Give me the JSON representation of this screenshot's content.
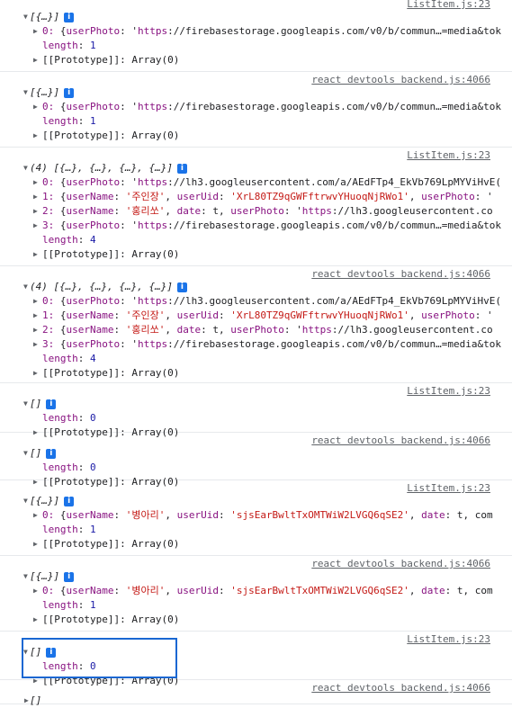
{
  "entries": [
    {
      "source": "ListItem.js:23",
      "top": 0,
      "header": "[{…}]",
      "expanded": true,
      "info": true,
      "items": [
        {
          "kind": "entry",
          "idx": "0",
          "value": "{userPhoto: 'https://firebasestorage.googleapis.com/v0/b/commun…=media&tok"
        },
        {
          "kind": "length",
          "value": "1"
        },
        {
          "kind": "proto",
          "value": "[[Prototype]]: Array(0)"
        }
      ]
    },
    {
      "source": "react devtools backend.js:4066",
      "header": "[{…}]",
      "expanded": true,
      "info": true,
      "items": [
        {
          "kind": "entry",
          "idx": "0",
          "value": "{userPhoto: 'https://firebasestorage.googleapis.com/v0/b/commun…=media&tok"
        },
        {
          "kind": "length",
          "value": "1"
        },
        {
          "kind": "proto",
          "value": "[[Prototype]]: Array(0)"
        }
      ]
    },
    {
      "source": "ListItem.js:23",
      "header": "(4) [{…}, {…}, {…}, {…}]",
      "expanded": true,
      "info": true,
      "items": [
        {
          "kind": "entry",
          "idx": "0",
          "value": "{userPhoto: 'https://lh3.googleusercontent.com/a/AEdFTp4_EkVb769LpMYViHvE("
        },
        {
          "kind": "entry",
          "idx": "1",
          "value": "{userName: '주인장', userUid: 'XrL80TZ9qGWFftrwvYHuoqNjRWo1', userPhoto: '"
        },
        {
          "kind": "entry",
          "idx": "2",
          "value": "{userName: '홍리쏘', date: t, userPhoto: 'https://lh3.googleusercontent.co"
        },
        {
          "kind": "entry",
          "idx": "3",
          "value": "{userPhoto: 'https://firebasestorage.googleapis.com/v0/b/commun…=media&tok"
        },
        {
          "kind": "length",
          "value": "4"
        },
        {
          "kind": "proto",
          "value": "[[Prototype]]: Array(0)"
        }
      ]
    },
    {
      "source": "react devtools backend.js:4066",
      "header": "(4) [{…}, {…}, {…}, {…}]",
      "expanded": true,
      "info": true,
      "items": [
        {
          "kind": "entry",
          "idx": "0",
          "value": "{userPhoto: 'https://lh3.googleusercontent.com/a/AEdFTp4_EkVb769LpMYViHvE("
        },
        {
          "kind": "entry",
          "idx": "1",
          "value": "{userName: '주인장', userUid: 'XrL80TZ9qGWFftrwvYHuoqNjRWo1', userPhoto: '"
        },
        {
          "kind": "entry",
          "idx": "2",
          "value": "{userName: '홍리쏘', date: t, userPhoto: 'https://lh3.googleusercontent.co"
        },
        {
          "kind": "entry",
          "idx": "3",
          "value": "{userPhoto: 'https://firebasestorage.googleapis.com/v0/b/commun…=media&tok"
        },
        {
          "kind": "length",
          "value": "4"
        },
        {
          "kind": "proto",
          "value": "[[Prototype]]: Array(0)"
        }
      ]
    },
    {
      "source": "ListItem.js:23",
      "header": "[]",
      "expanded": true,
      "info": true,
      "items": [
        {
          "kind": "length",
          "value": "0"
        },
        {
          "kind": "proto",
          "value": "[[Prototype]]: Array(0)"
        }
      ]
    },
    {
      "source": "react devtools backend.js:4066",
      "header": "[]",
      "expanded": true,
      "info": true,
      "items": [
        {
          "kind": "length",
          "value": "0"
        },
        {
          "kind": "proto",
          "value": "[[Prototype]]: Array(0)"
        }
      ]
    },
    {
      "source": "ListItem.js:23",
      "header": "[{…}]",
      "expanded": true,
      "info": true,
      "items": [
        {
          "kind": "entry",
          "idx": "0",
          "value": "{userName: '병아리', userUid: 'sjsEarBwltTxOMTWiW2LVGQ6qSE2', date: t, com"
        },
        {
          "kind": "length",
          "value": "1"
        },
        {
          "kind": "proto",
          "value": "[[Prototype]]: Array(0)"
        }
      ]
    },
    {
      "source": "react devtools backend.js:4066",
      "header": "[{…}]",
      "expanded": true,
      "info": true,
      "items": [
        {
          "kind": "entry",
          "idx": "0",
          "value": "{userName: '병아리', userUid: 'sjsEarBwltTxOMTWiW2LVGQ6qSE2', date: t, com"
        },
        {
          "kind": "length",
          "value": "1"
        },
        {
          "kind": "proto",
          "value": "[[Prototype]]: Array(0)"
        }
      ]
    },
    {
      "source": "ListItem.js:23",
      "header": "[]",
      "expanded": true,
      "info": true,
      "items": [
        {
          "kind": "length",
          "value": "0"
        },
        {
          "kind": "proto",
          "value": "[[Prototype]]: Array(0)"
        }
      ]
    },
    {
      "source": "react devtools backend.js:4066",
      "header": "[]",
      "expanded": false,
      "info": false,
      "items": []
    }
  ],
  "labels": {
    "length_key": "length",
    "triangle_open": "▼",
    "triangle_closed": "▶",
    "info_glyph": "i"
  }
}
